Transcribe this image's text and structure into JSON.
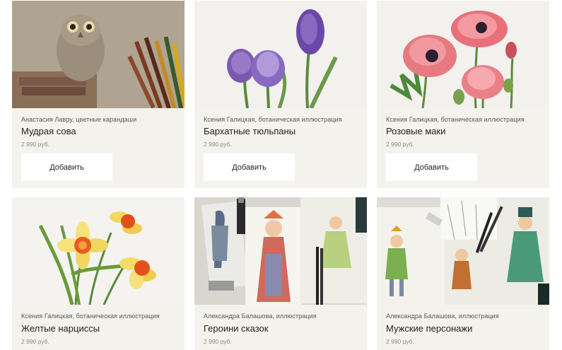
{
  "products": [
    {
      "author": "Анастасия Лавру, цветные карандаши",
      "title": "Мудрая сова",
      "price": "2 990 руб.",
      "button": "Добавить",
      "image_icon": "owl-drawing-image"
    },
    {
      "author": "Ксения Галицкая, ботаническая иллюстрация",
      "title": "Бархатные тюльпаны",
      "price": "2 990 руб.",
      "button": "Добавить",
      "image_icon": "tulips-painting-image"
    },
    {
      "author": "Ксения Галицкая, ботаническая иллюстрация",
      "title": "Розовые маки",
      "price": "2 990 руб.",
      "button": "Добавить",
      "image_icon": "poppies-painting-image"
    },
    {
      "author": "Ксения Галицкая, ботаническая иллюстрация",
      "title": "Желтые нарциссы",
      "price": "2 990 руб.",
      "image_icon": "daffodils-painting-image"
    },
    {
      "author": "Александра Балашова, иллюстрация",
      "title": "Героини сказок",
      "price": "2 990 руб.",
      "image_icon": "fairytale-heroines-image"
    },
    {
      "author": "Александра Балашова, иллюстрация",
      "title": "Мужские персонажи",
      "price": "2 990 руб.",
      "image_icon": "male-characters-image"
    }
  ],
  "colors": {
    "card_bg": "#f3f2ec",
    "button_bg": "#ffffff",
    "text": "#222222",
    "muted": "#8a8a8a"
  }
}
